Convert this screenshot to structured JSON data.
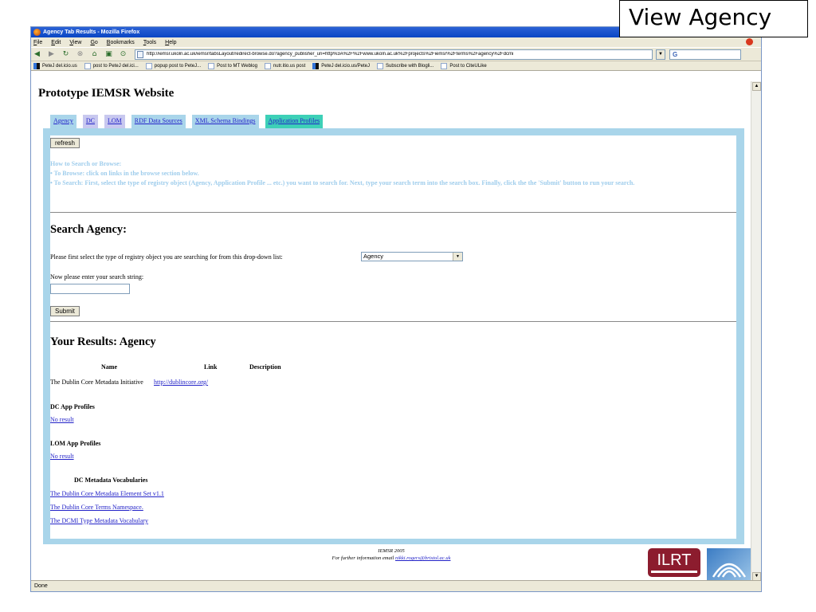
{
  "window": {
    "title": "Agency Tab Results - Mozilla Firefox",
    "status": "Done"
  },
  "menu": [
    "File",
    "Edit",
    "View",
    "Go",
    "Bookmarks",
    "Tools",
    "Help"
  ],
  "nav": {
    "url": "http://iemsr.ukoln.ac.uk/iemsr/tabsLayout/redirect-browse.do?agency_publisher_uri=http%3A%2F%2Fwww.ukoln.ac.uk%2Fprojects%2Fiemsr%2Fterms%2Fagency%2Fdcmi",
    "search_value": "G"
  },
  "bookmarks": [
    "PeteJ del.icio.us",
    "post to PeteJ del.ici...",
    "popup post to PeteJ...",
    "Post to MT Weblog",
    "nutr.itio.us post",
    "PeteJ del.icio.us/PeteJ",
    "Subscribe with Blogli...",
    "Post to CiteULike"
  ],
  "page": {
    "title": "Prototype IEMSR Website",
    "tabs": [
      "Agency",
      "DC",
      "LOM",
      "RDF Data Sources",
      "XML Schema Bindings",
      "Application Profiles"
    ],
    "refresh_label": "refresh",
    "howto": {
      "heading": "How to Search or Browse:",
      "browse": "•  To Browse: click on links in the browse section below.",
      "search": "•  To Search: First, select the type of registry object (Agency, Application Profile ... etc.) you want to search for. Next, type your search term into the search box. Finally, click the the 'Submit' button to run your search."
    },
    "search": {
      "heading": "Search Agency:",
      "select_prompt": "Please first select the type of registry object you are searching for from this drop-down list:",
      "select_value": "Agency",
      "input_prompt": "Now please enter your search string:",
      "input_value": "",
      "submit_label": "Submit"
    },
    "results": {
      "heading": "Your Results: Agency",
      "columns": [
        "Name",
        "Link",
        "Description"
      ],
      "row": {
        "name": "The Dublin Core Metadata Initiative",
        "link": "http://dublincore.org/"
      },
      "dc_app_profiles": {
        "heading": "DC App Profiles",
        "value": "No result"
      },
      "lom_app_profiles": {
        "heading": "LOM App Profiles",
        "value": "No result"
      },
      "vocabularies": {
        "heading": "DC Metadata Vocabularies",
        "items": [
          "The Dublin Core Metadata Element Set v1.1",
          "The Dublin Core Terms Namespace.",
          "The DCMI Type Metadata Vocabulary"
        ]
      }
    },
    "footer": {
      "line1": "IEMSR 2005",
      "line2_prefix": "For further information email",
      "email": "nikki.rogers@bristol.ac.uk",
      "logo": "ILRT"
    }
  },
  "overlay_label": "View Agency",
  "icons": [
    "firefox-icon",
    "back-icon",
    "forward-icon",
    "reload-icon",
    "stop-icon",
    "home-icon",
    "history-icon",
    "go-icon",
    "page-icon",
    "bookmark-icon"
  ]
}
